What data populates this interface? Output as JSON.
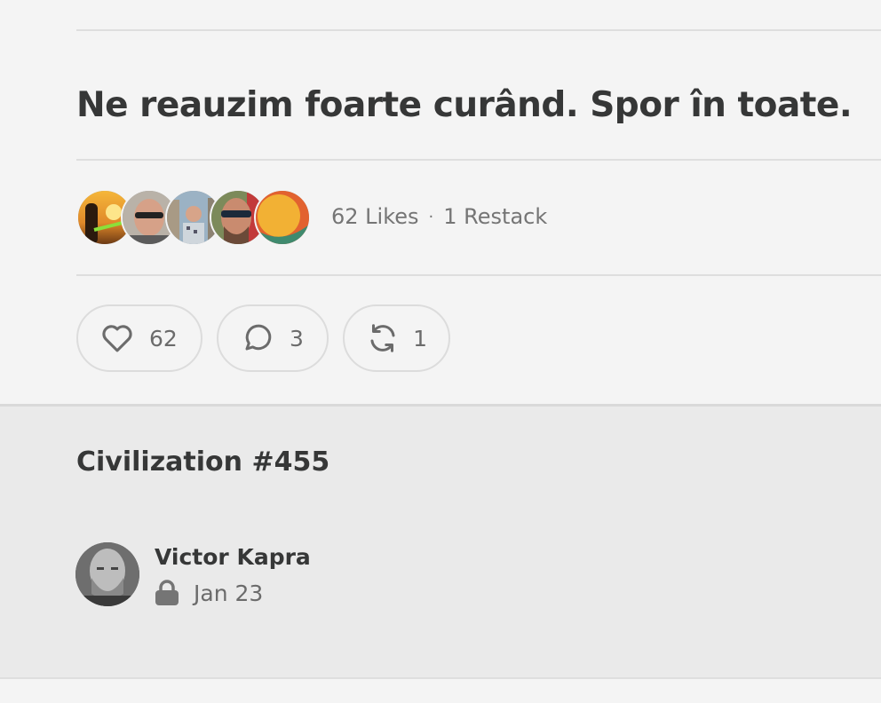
{
  "post": {
    "heading": "Ne reauzim foarte curând. Spor în toate.",
    "likes_label": "62 Likes",
    "separator": "·",
    "restacks_label": "1 Restack"
  },
  "likers": [
    {
      "name": "liker-avatar-1"
    },
    {
      "name": "liker-avatar-2"
    },
    {
      "name": "liker-avatar-3"
    },
    {
      "name": "liker-avatar-4"
    },
    {
      "name": "liker-avatar-5"
    }
  ],
  "actions": {
    "like": {
      "icon": "heart-icon",
      "count": "62"
    },
    "comment": {
      "icon": "comment-bubble-icon",
      "count": "3"
    },
    "restack": {
      "icon": "restack-arrows-icon",
      "count": "1"
    }
  },
  "related": {
    "title": "Civilization #455",
    "author": "Victor Kapra",
    "date": "Jan 23",
    "lock_icon": "lock-icon"
  },
  "colors": {
    "background": "#f4f4f4",
    "related_background": "#eaeaea",
    "text_primary": "#363737",
    "text_secondary": "#757575",
    "divider": "#dedede"
  }
}
